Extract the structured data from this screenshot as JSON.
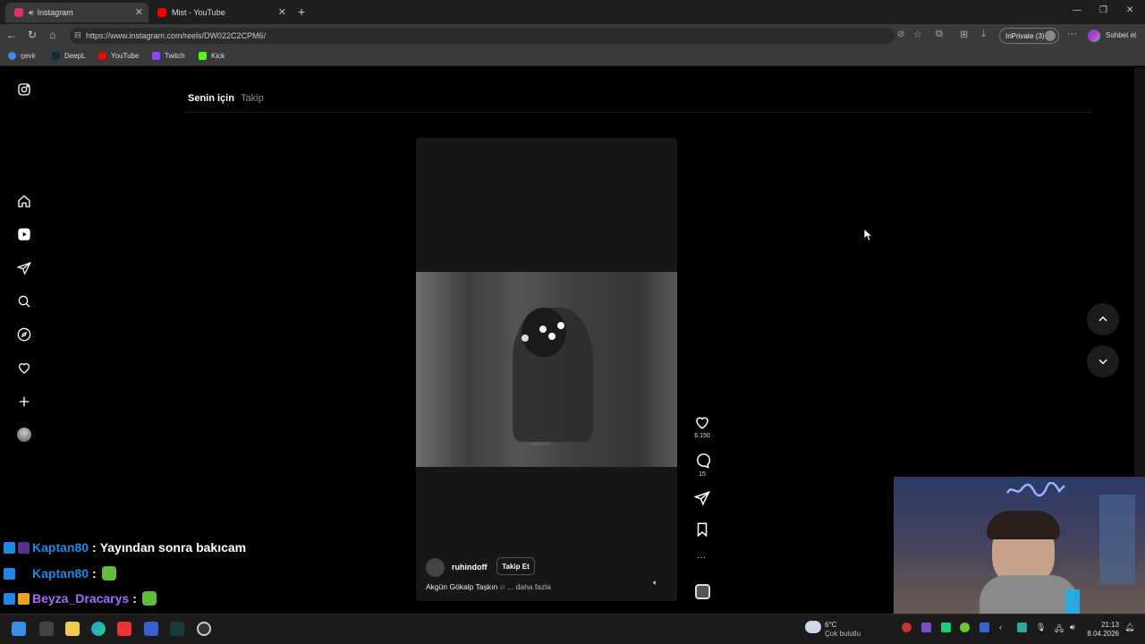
{
  "browser": {
    "tabs": [
      {
        "title": "Instagram",
        "active": true
      },
      {
        "title": "Mist - YouTube",
        "active": false
      }
    ],
    "url": "https://www.instagram.com/reels/DW022C2CPM6/",
    "inprivate_label": "InPrivate (3)",
    "copilot_label": "Sohbet et",
    "bookmarks": [
      "çevir",
      "DeepL",
      "YouTube",
      "Twitch",
      "Kick"
    ]
  },
  "instagram": {
    "feed_tabs": [
      "Senin için",
      "Takip"
    ],
    "reel": {
      "username": "ruhindoff",
      "follow_label": "Takip Et",
      "caption": "Akgün Gökalp Taşkın",
      "more_label": "... daha fazla",
      "watermark": "RuhinDoff",
      "likes": "6.150",
      "comments": "15"
    }
  },
  "chat": [
    {
      "user": "Kaptan80",
      "message": "Yayından sonra bakıcam",
      "user_color": "#1e88e5"
    },
    {
      "user": "Kaptan80",
      "message": "",
      "user_color": "#1e88e5"
    },
    {
      "user": "Beyza_Dracarys",
      "message": "",
      "user_color": "#a66bff"
    }
  ],
  "taskbar": {
    "weather_temp": "6°C",
    "weather_desc": "Çok bulutlu",
    "time": "21:13",
    "date": "8.04.2026"
  },
  "colors": {
    "instagram_tab": "#e1306c",
    "youtube_red": "#ff0000",
    "twitch_purple": "#9146ff",
    "kick_green": "#53fc18"
  }
}
